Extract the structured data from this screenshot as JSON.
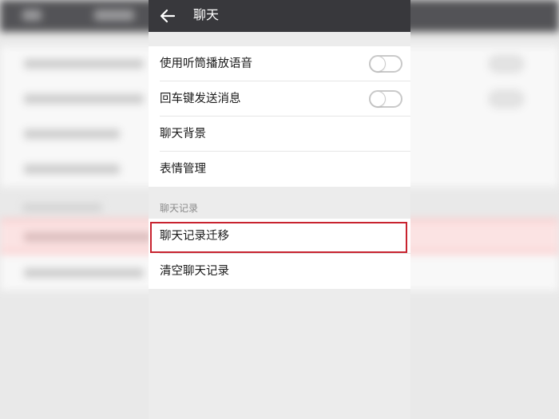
{
  "header": {
    "back_icon": "arrow-left-icon",
    "title": "聊天"
  },
  "settings": {
    "earpiece_label": "使用听筒播放语音",
    "earpiece_on": false,
    "enter_send_label": "回车键发送消息",
    "enter_send_on": false,
    "background_label": "聊天背景",
    "sticker_label": "表情管理"
  },
  "history": {
    "section_title": "聊天记录",
    "migrate_label": "聊天记录迁移",
    "clear_label": "清空聊天记录"
  },
  "colors": {
    "topbar": "#38383c",
    "highlight": "#c8232f",
    "page_bg": "#ececec"
  }
}
